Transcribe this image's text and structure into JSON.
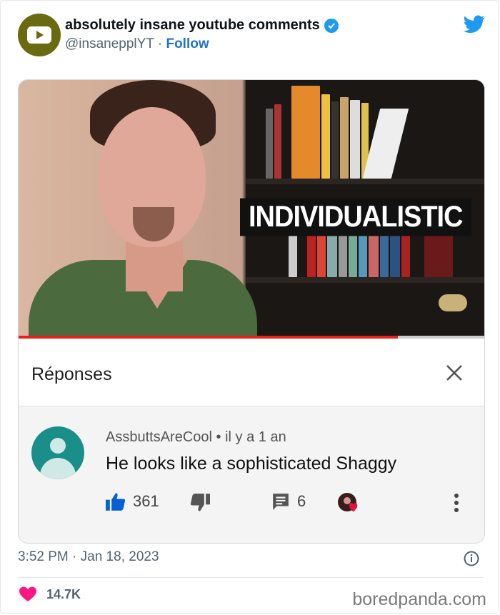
{
  "author": {
    "name": "absolutely insane youtube comments",
    "handle": "@insanepplYT",
    "separator": "·",
    "follow_label": "Follow"
  },
  "video": {
    "caption": "INDIVIDUALISTIC",
    "progress": 0.815
  },
  "replies_panel": {
    "title": "Réponses"
  },
  "comment": {
    "username": "AssbuttsAreCool",
    "meta_separator": "•",
    "age": "il y a 1 an",
    "text": "He looks like a sophisticated Shaggy",
    "likes": "361",
    "replies": "6"
  },
  "footer": {
    "timestamp": "3:52 PM · Jan 18, 2023",
    "like_count": "14.7K",
    "watermark": "boredpanda.com"
  },
  "colors": {
    "twitter_blue": "#1d9bf0",
    "like_red": "#f91880",
    "youtube_red": "#e62117",
    "youtube_like_blue": "#065fd4"
  }
}
